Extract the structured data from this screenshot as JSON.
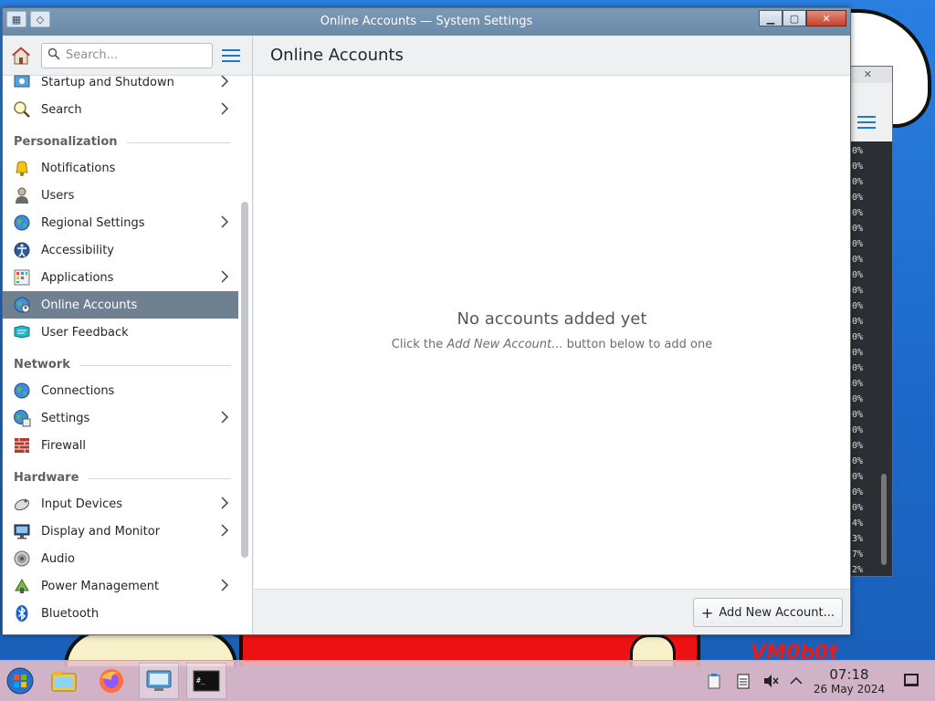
{
  "window": {
    "title": "Online Accounts — System Settings"
  },
  "sidebar": {
    "search_placeholder": "Search...",
    "items_top": [
      {
        "label": "Startup and Shutdown",
        "icon": "startup-icon",
        "chevron": true
      },
      {
        "label": "Search",
        "icon": "search-icon",
        "chevron": true
      }
    ],
    "sections": [
      {
        "title": "Personalization",
        "items": [
          {
            "label": "Notifications",
            "icon": "bell-icon",
            "chevron": false
          },
          {
            "label": "Users",
            "icon": "user-icon",
            "chevron": false
          },
          {
            "label": "Regional Settings",
            "icon": "globe-icon",
            "chevron": true
          },
          {
            "label": "Accessibility",
            "icon": "accessibility-icon",
            "chevron": false
          },
          {
            "label": "Applications",
            "icon": "applications-icon",
            "chevron": true
          },
          {
            "label": "Online Accounts",
            "icon": "online-accounts-icon",
            "chevron": false,
            "selected": true
          },
          {
            "label": "User Feedback",
            "icon": "feedback-icon",
            "chevron": false
          }
        ]
      },
      {
        "title": "Network",
        "items": [
          {
            "label": "Connections",
            "icon": "connections-icon",
            "chevron": false
          },
          {
            "label": "Settings",
            "icon": "network-settings-icon",
            "chevron": true
          },
          {
            "label": "Firewall",
            "icon": "firewall-icon",
            "chevron": false
          }
        ]
      },
      {
        "title": "Hardware",
        "items": [
          {
            "label": "Input Devices",
            "icon": "input-devices-icon",
            "chevron": true
          },
          {
            "label": "Display and Monitor",
            "icon": "display-icon",
            "chevron": true
          },
          {
            "label": "Audio",
            "icon": "audio-icon",
            "chevron": false
          },
          {
            "label": "Power Management",
            "icon": "power-icon",
            "chevron": true
          },
          {
            "label": "Bluetooth",
            "icon": "bluetooth-icon",
            "chevron": false
          }
        ]
      }
    ]
  },
  "main": {
    "page_title": "Online Accounts",
    "empty_heading": "No accounts added yet",
    "empty_sub_pre": "Click the ",
    "empty_sub_em": "Add New Account...",
    "empty_sub_post": " button below to add one",
    "add_button_label": "Add New Account..."
  },
  "taskbar": {
    "time": "07:18",
    "date": "26 May 2024",
    "apps": [
      "start-menu-icon",
      "file-manager-icon",
      "firefox-icon",
      "system-settings-icon",
      "terminal-icon"
    ]
  },
  "background_terminal": {
    "lines": [
      "0%",
      "0%",
      "0%",
      "0%",
      "0%",
      "0%",
      "0%",
      "0%",
      "0%",
      "0%",
      "0%",
      "0%",
      "0%",
      "0%",
      "0%",
      "0%",
      "0%",
      "0%",
      "0%",
      "0%",
      "0%",
      "0%",
      "0%",
      "0%",
      "4%",
      "3%",
      "7%",
      "2%"
    ]
  },
  "colors": {
    "selection": "#6f8190",
    "accent": "#1d79c9",
    "titlebar": "#6a8aa8"
  }
}
